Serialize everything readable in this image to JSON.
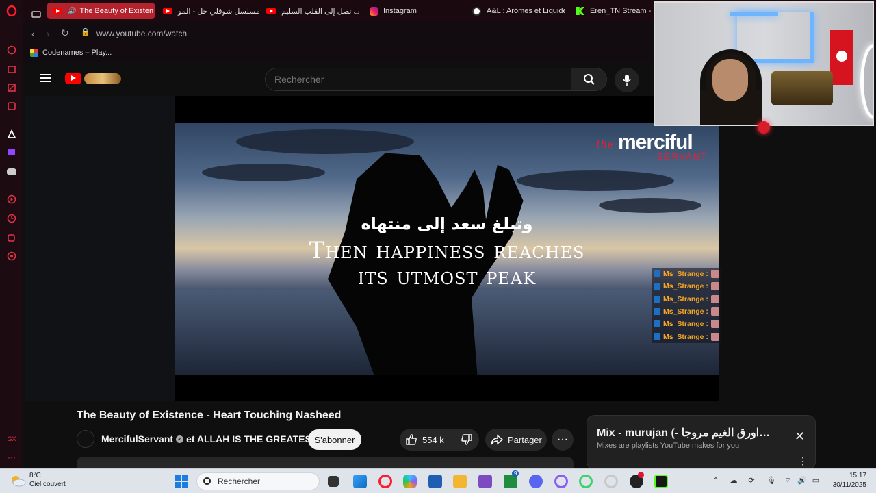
{
  "browser": {
    "tabs": [
      {
        "label": "The Beauty of Existen",
        "active": true,
        "icon": "youtube-icon"
      },
      {
        "label": "مسلسل شوقلي حل - المو",
        "active": false,
        "icon": "youtube-icon"
      },
      {
        "label": "كيف تصل إلى القلب السليم",
        "active": false,
        "icon": "youtube-icon"
      },
      {
        "label": "Instagram",
        "active": false,
        "icon": "instagram-icon"
      },
      {
        "label": "A&L : Arômes et Liquide",
        "active": false,
        "icon": "panda-icon"
      },
      {
        "label": "Eren_TN Stream - W",
        "active": false,
        "icon": "kick-icon"
      }
    ],
    "url": "www.youtube.com/watch",
    "bookmark": "Codenames – Play..."
  },
  "youtube": {
    "search_placeholder": "Rechercher",
    "video": {
      "logo_the": "the",
      "logo_merciful": "merciful",
      "logo_servant": "SERVANT",
      "subtitle_ar": "وتبلغ سعد إلى منتهاه",
      "subtitle_en_line1": "Then happiness reaches",
      "subtitle_en_line2": "its utmost peak"
    },
    "chat": [
      {
        "user": "Ms_Strange :"
      },
      {
        "user": "Ms_Strange :"
      },
      {
        "user": "Ms_Strange :"
      },
      {
        "user": "Ms_Strange :"
      },
      {
        "user": "Ms_Strange :"
      },
      {
        "user": "Ms_Strange :"
      }
    ],
    "title": "The Beauty of Existence - Heart Touching Nasheed",
    "channel": "MercifulServant",
    "channel_suffix": "et ALLAH IS THE GREATEST",
    "subscribe": "S'abonner",
    "likes": "554 k",
    "share": "Partager",
    "mix": {
      "title": "Mix - murujan (- اورق الغيم مروجا…",
      "subtitle": "Mixes are playlists YouTube makes for you"
    }
  },
  "taskbar": {
    "weather_temp": "8°C",
    "weather_desc": "Ciel couvert",
    "search": "Rechercher",
    "time": "15:17",
    "date": "30/11/2025",
    "badge": "9"
  },
  "colors": {
    "opera_red": "#b3222d",
    "youtube_red": "#ff0000",
    "chat_name": "#f5a623"
  }
}
